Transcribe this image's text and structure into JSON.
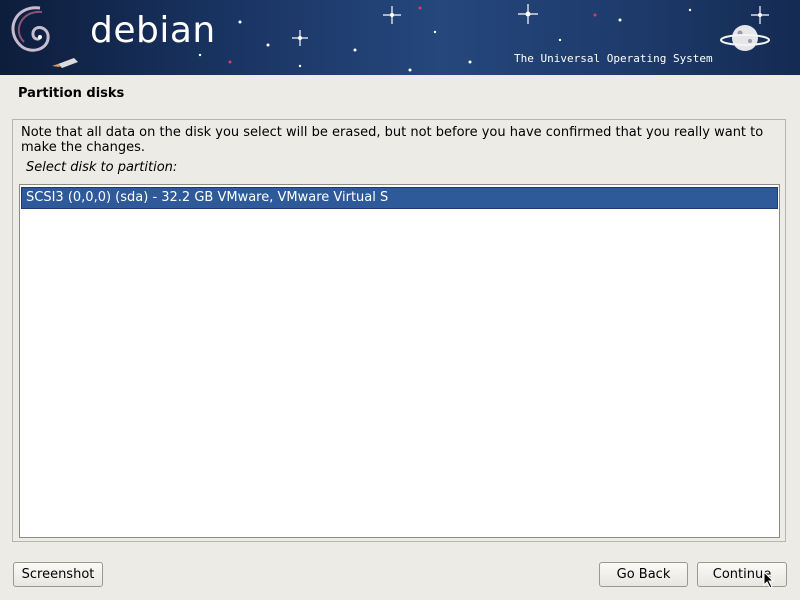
{
  "banner": {
    "logo": "debian",
    "tagline": "The Universal Operating System"
  },
  "page": {
    "title": "Partition disks",
    "note": "Note that all data on the disk you select will be erased, but not before you have confirmed that you really want to make the changes.",
    "prompt": "Select disk to partition:"
  },
  "disks": [
    {
      "label": "SCSI3 (0,0,0) (sda) - 32.2 GB VMware, VMware Virtual S",
      "selected": true
    }
  ],
  "buttons": {
    "screenshot": "Screenshot",
    "back": "Go Back",
    "continue": "Continue"
  },
  "colors": {
    "selection": "#2e5a99",
    "background": "#edebe6"
  }
}
